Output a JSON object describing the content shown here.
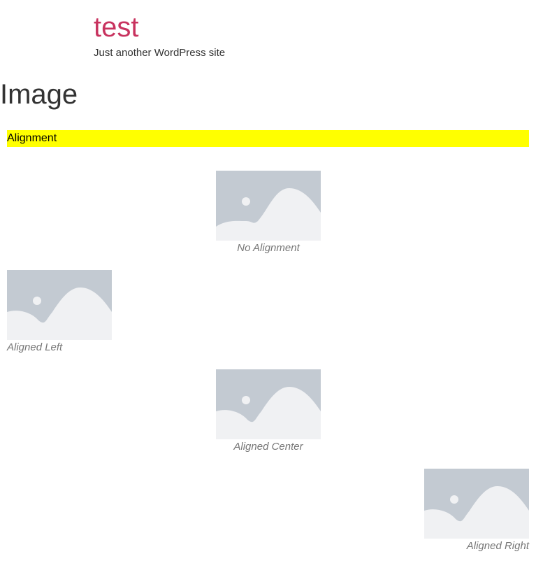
{
  "site": {
    "title": "test",
    "description": "Just another WordPress site",
    "title_color": "#c8335f"
  },
  "page": {
    "title": "Image"
  },
  "section": {
    "heading": "Alignment",
    "highlight_color": "#ffff00"
  },
  "figures": [
    {
      "caption": "No Alignment",
      "alignment": "none",
      "icon": "image-placeholder-icon"
    },
    {
      "caption": "Aligned Left",
      "alignment": "left",
      "icon": "image-placeholder-icon"
    },
    {
      "caption": "Aligned Center",
      "alignment": "center",
      "icon": "image-placeholder-icon"
    },
    {
      "caption": "Aligned Right",
      "alignment": "right",
      "icon": "image-placeholder-icon"
    }
  ],
  "colors": {
    "placeholder_bg": "#c3cad2",
    "placeholder_fg": "#f0f1f3",
    "caption": "#767676"
  }
}
